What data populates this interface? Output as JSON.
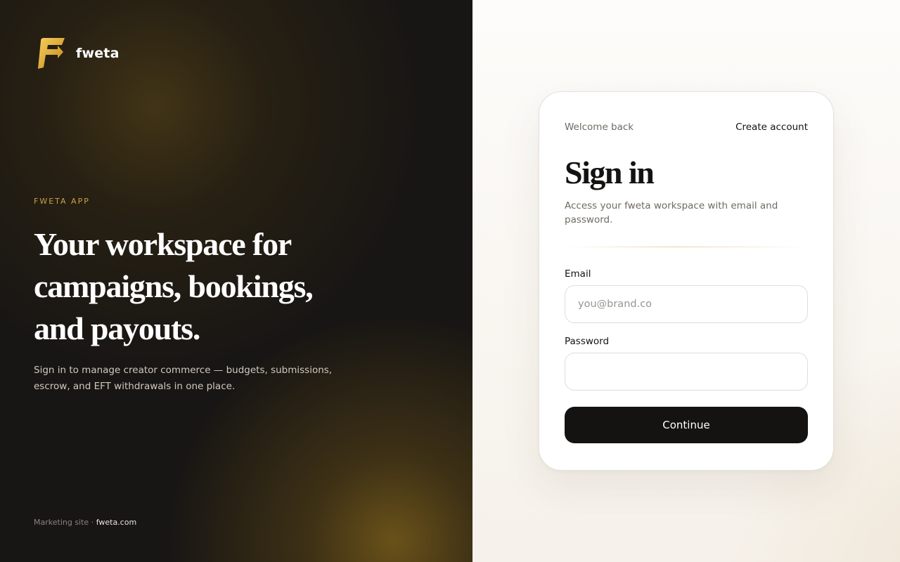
{
  "brand": {
    "name": "fweta",
    "logo_icon": "fweta-logo-icon",
    "logo_colors": [
      "#f5c244",
      "#c98a17"
    ]
  },
  "hero": {
    "eyebrow": "FWETA APP",
    "headline": "Your workspace for campaigns, bookings, and payouts.",
    "lede": "Sign in to manage creator commerce — budgets, submissions, escrow, and EFT withdrawals in one place."
  },
  "footer": {
    "prefix": "Marketing site ·",
    "link_text": "fweta.com"
  },
  "signin": {
    "welcome": "Welcome back",
    "create_account": "Create account",
    "title": "Sign in",
    "subtitle": "Access your fweta workspace with email and password.",
    "email_label": "Email",
    "email_placeholder": "you@brand.co",
    "email_value": "",
    "password_label": "Password",
    "password_value": "",
    "continue_label": "Continue"
  },
  "colors": {
    "accent_gold": "#c9a24a",
    "dark": "#141312",
    "panel_dark": "#181614"
  }
}
